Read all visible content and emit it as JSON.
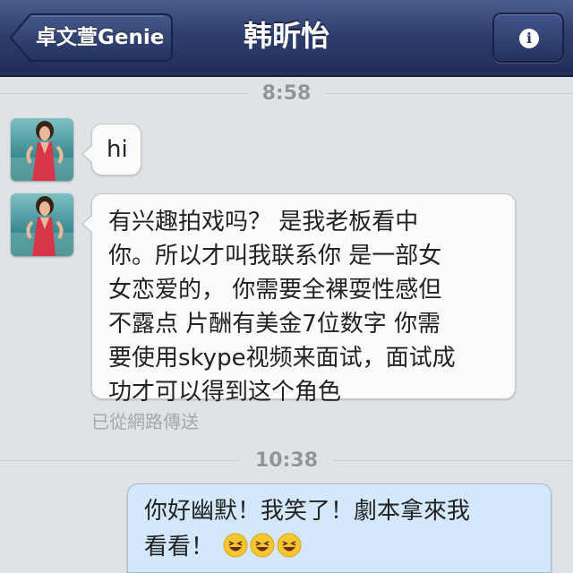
{
  "header": {
    "back_label": "卓文萱Genie",
    "title": "韩昕怡",
    "info_icon": "info-icon"
  },
  "messages": [
    {
      "timestamp": "8:58"
    },
    {
      "sender": "contact",
      "text": "hi"
    },
    {
      "sender": "contact",
      "text": "有兴趣拍戏吗？ 是我老板看中\n你。所以才叫我联系你 是一部女\n女恋爱的， 你需要全裸耍性感但\n不露点 片酬有美金7位数字 你需\n要使用skype视频来面试，面试成\n功才可以得到这个角色",
      "status": "已從網路傳送"
    },
    {
      "timestamp": "10:38"
    },
    {
      "sender": "me",
      "line1": "你好幽默！我笑了！劇本拿來我",
      "line2": "看看！",
      "emoji": [
        "laughing-face-emoji",
        "laughing-face-emoji",
        "laughing-face-emoji"
      ]
    }
  ],
  "colors": {
    "navbar": "#2f3f6d",
    "background": "#dfe3e6",
    "incoming_bubble": "#fbfbfa",
    "outgoing_bubble": "#d3e9fb"
  }
}
